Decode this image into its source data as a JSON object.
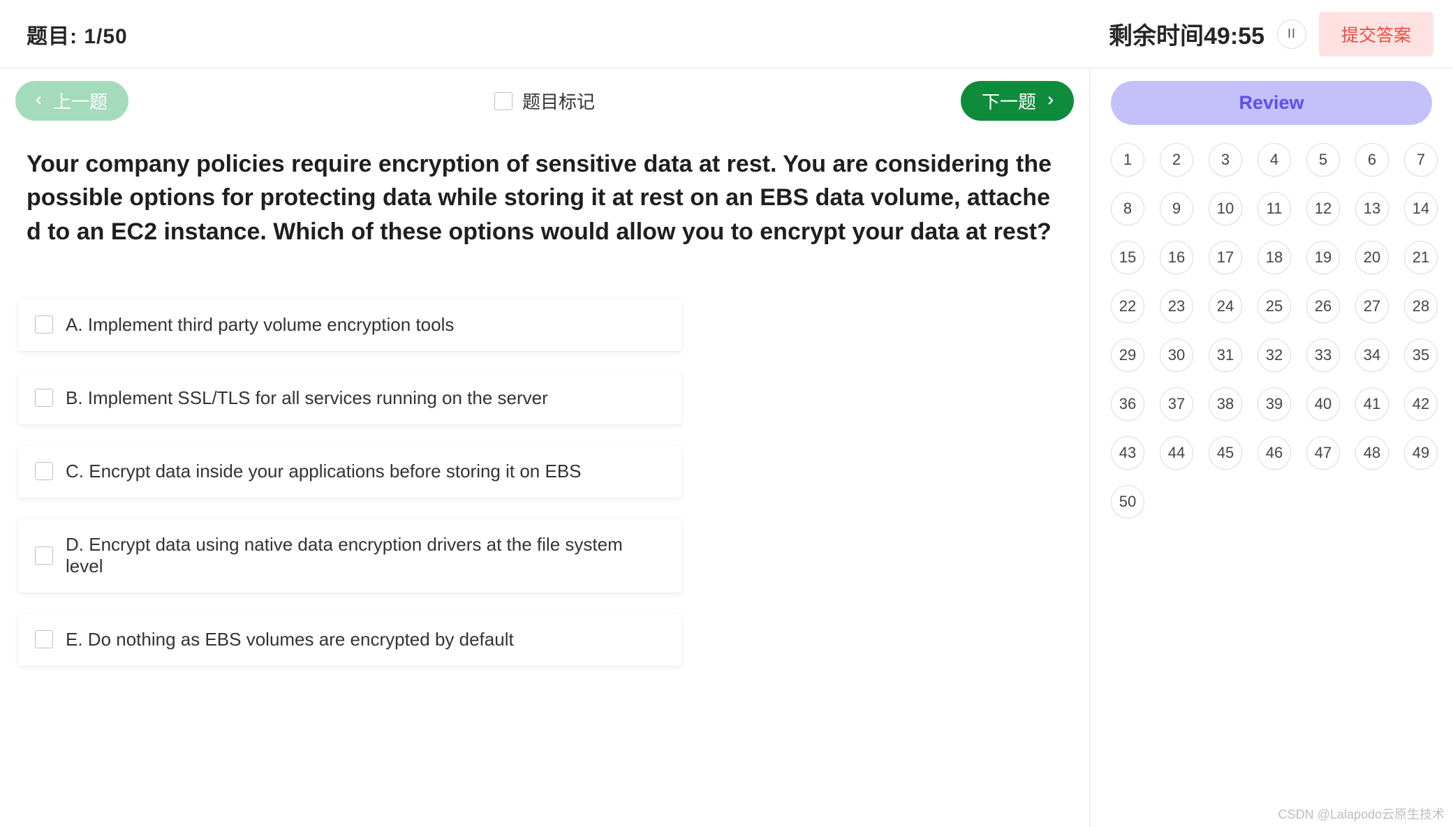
{
  "header": {
    "question_counter": "题目: 1/50",
    "timer_label": "剩余时间49:55",
    "pause_glyph": "II",
    "submit_label": "提交答案"
  },
  "nav": {
    "prev_label": "上一题",
    "next_label": "下一题",
    "mark_label": "题目标记"
  },
  "question": {
    "text": "Your company policies require encryption of sensitive data at rest. You are considering the possible options for protecting data while storing it at rest on an EBS data volume, attached to an EC2 instance. Which of these options would allow you to encrypt your data at rest?"
  },
  "answers": [
    {
      "label": "A. Implement third party volume encryption tools"
    },
    {
      "label": "B. Implement SSL/TLS for all services running on the server"
    },
    {
      "label": "C. Encrypt data inside your applications before storing it on EBS"
    },
    {
      "label": "D. Encrypt data using native data encryption drivers at the file system level"
    },
    {
      "label": "E. Do nothing as EBS volumes are encrypted by default"
    }
  ],
  "sidebar": {
    "review_label": "Review",
    "total_questions": 50
  },
  "watermark": "CSDN @Lalapodo云原生技术"
}
